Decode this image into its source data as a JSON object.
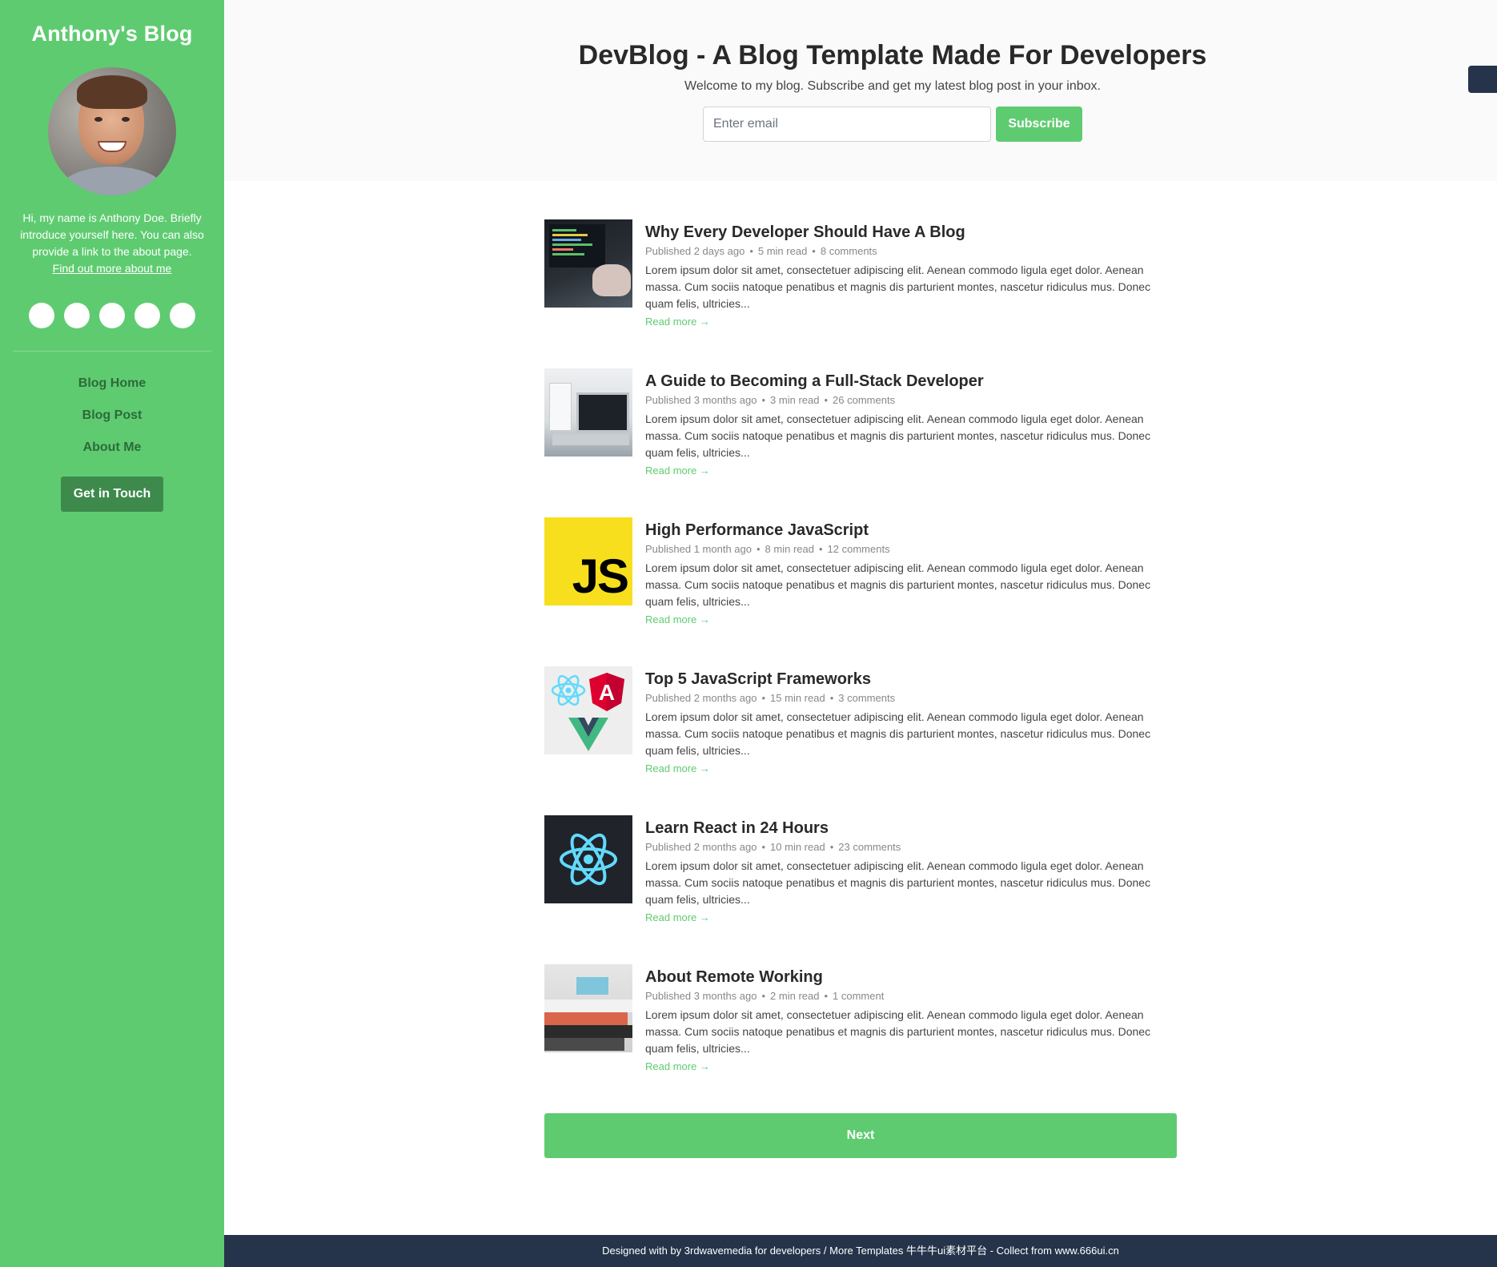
{
  "sidebar": {
    "brand": "Anthony's Blog",
    "bio": "Hi, my name is Anthony Doe. Briefly introduce yourself here. You can also provide a link to the about page.",
    "bio_link": "Find out more about me",
    "nav": [
      {
        "label": "Blog Home"
      },
      {
        "label": "Blog Post"
      },
      {
        "label": "About Me"
      }
    ],
    "cta": "Get in Touch"
  },
  "header": {
    "title": "DevBlog - A Blog Template Made For Developers",
    "subtitle": "Welcome to my blog. Subscribe and get my latest blog post in your inbox.",
    "email_placeholder": "Enter email",
    "subscribe_label": "Subscribe"
  },
  "posts": [
    {
      "title": "Why Every Developer Should Have A Blog",
      "date": "Published 2 days ago",
      "time": "5 min read",
      "comments": "8 comments",
      "intro": "Lorem ipsum dolor sit amet, consectetuer adipiscing elit. Aenean commodo ligula eget dolor. Aenean massa. Cum sociis natoque penatibus et magnis dis parturient montes, nascetur ridiculus mus. Donec quam felis, ultricies...",
      "read_more": "Read more →",
      "thumb": "laptop-code-image"
    },
    {
      "title": "A Guide to Becoming a Full-Stack Developer",
      "date": "Published 3 months ago",
      "time": "3 min read",
      "comments": "26 comments",
      "intro": "Lorem ipsum dolor sit amet, consectetuer adipiscing elit. Aenean commodo ligula eget dolor. Aenean massa. Cum sociis natoque penatibus et magnis dis parturient montes, nascetur ridiculus mus. Donec quam felis, ultricies...",
      "read_more": "Read more →",
      "thumb": "desk-laptop-image"
    },
    {
      "title": "High Performance JavaScript",
      "date": "Published 1 month ago",
      "time": "8 min read",
      "comments": "12 comments",
      "intro": "Lorem ipsum dolor sit amet, consectetuer adipiscing elit. Aenean commodo ligula eget dolor. Aenean massa. Cum sociis natoque penatibus et magnis dis parturient montes, nascetur ridiculus mus. Donec quam felis, ultricies...",
      "read_more": "Read more →",
      "thumb": "javascript-logo",
      "thumb_text": "JS"
    },
    {
      "title": "Top 5 JavaScript Frameworks",
      "date": "Published 2 months ago",
      "time": "15 min read",
      "comments": "3 comments",
      "intro": "Lorem ipsum dolor sit amet, consectetuer adipiscing elit. Aenean commodo ligula eget dolor. Aenean massa. Cum sociis natoque penatibus et magnis dis parturient montes, nascetur ridiculus mus. Donec quam felis, ultricies...",
      "read_more": "Read more →",
      "thumb": "frameworks-logos"
    },
    {
      "title": "Learn React in 24 Hours",
      "date": "Published 2 months ago",
      "time": "10 min read",
      "comments": "23 comments",
      "intro": "Lorem ipsum dolor sit amet, consectetuer adipiscing elit. Aenean commodo ligula eget dolor. Aenean massa. Cum sociis natoque penatibus et magnis dis parturient montes, nascetur ridiculus mus. Donec quam felis, ultricies...",
      "read_more": "Read more →",
      "thumb": "react-logo"
    },
    {
      "title": "About Remote Working",
      "date": "Published 3 months ago",
      "time": "2 min read",
      "comments": "1 comment",
      "intro": "Lorem ipsum dolor sit amet, consectetuer adipiscing elit. Aenean commodo ligula eget dolor. Aenean massa. Cum sociis natoque penatibus et magnis dis parturient montes, nascetur ridiculus mus. Donec quam felis, ultricies...",
      "read_more": "Read more →",
      "thumb": "books-image"
    }
  ],
  "pagination": {
    "next": "Next"
  },
  "footer": {
    "text": "Designed with by 3rdwavemedia for developers / More Templates 牛牛牛ui素材平台 - Collect from ",
    "link": "www.666ui.cn"
  },
  "colors": {
    "accent": "#5fcb71",
    "dark": "#25344a",
    "button_dark": "#3d8a4c"
  }
}
